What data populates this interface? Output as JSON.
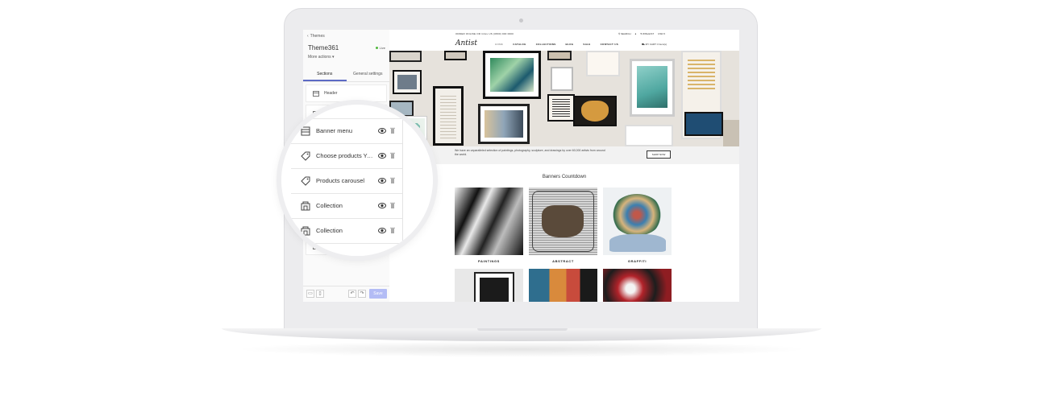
{
  "editor": {
    "back_label": "Themes",
    "theme_name": "Theme361",
    "status": "Live",
    "more_actions": "More actions",
    "tabs": [
      {
        "label": "Sections",
        "active": true
      },
      {
        "label": "General settings",
        "active": false
      }
    ],
    "sections_visible": [
      {
        "label": "Header"
      },
      {
        "label": ""
      }
    ],
    "save_label": "Save"
  },
  "magnified_sections": [
    {
      "label": "Banner menu",
      "icon": "layout-icon"
    },
    {
      "label": "Choose products Your...",
      "icon": "tag-icon"
    },
    {
      "label": "Products carousel",
      "icon": "tag-icon"
    },
    {
      "label": "Collection",
      "icon": "collection-icon"
    },
    {
      "label": "Collection",
      "icon": "collection-icon"
    }
  ],
  "store": {
    "topbar_left": "ORDER ONLINE OR CALL US (0800) 000 0000",
    "topbar_search": "SEARCH",
    "topbar_wishlist": "WISHLIST",
    "topbar_currency": "USD",
    "logo": "Antist",
    "nav": [
      "HOME",
      "CATALOG",
      "COLLECTIONS",
      "BLOG",
      "SALE",
      "CONTACT US"
    ],
    "cart": "MY CART: 0 item(s)",
    "hero_text": "We have an unparalleled selection of paintings, photography, sculpture, and drawings by over 60,000 artists from around the world.",
    "shop_now": "SHOP NOW",
    "section_title": "Banners Countdown",
    "tiles": [
      {
        "label": "PAINTINGS"
      },
      {
        "label": "ABSTRACT"
      },
      {
        "label": "GRAFFITI"
      }
    ]
  },
  "colors": {
    "accent": "#5c6ac4",
    "save_button": "#b3bcf5",
    "live": "#50b83c"
  }
}
